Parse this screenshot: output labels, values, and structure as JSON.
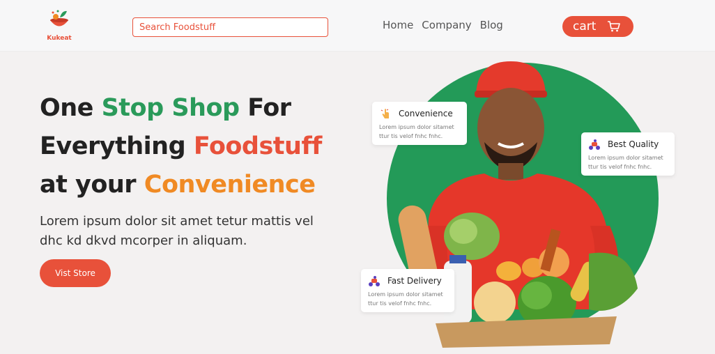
{
  "header": {
    "logo_text": "Kukeat",
    "search_placeholder": "Search Foodstuff",
    "nav": [
      "Home",
      "Company",
      "Blog"
    ],
    "cart_label": "cart"
  },
  "hero": {
    "title_line1_a": "One ",
    "title_line1_b": "Stop Shop",
    "title_line1_c": " For",
    "title_line2_a": "Everything ",
    "title_line2_b": "Foodstuff",
    "title_line3_a": "at your ",
    "title_line3_b": "Convenience",
    "subtitle": "Lorem ipsum dolor sit amet tetur mattis vel dhc kd dkvd mcorper in aliquam.",
    "button": "Vist Store"
  },
  "cards": {
    "convenience": {
      "title": "Convenience",
      "body": "Lorem ipsum dolor sitamet ttur tis velof fnhc fnhc."
    },
    "quality": {
      "title": "Best Quality",
      "body": "Lorem ipsum dolor sitamet ttur tis velof fnhc fnhc."
    },
    "delivery": {
      "title": "Fast Delivery",
      "body": "Lorem ipsum dolor sitamet ttur tis velof fnhc fnhc."
    }
  },
  "colors": {
    "accent": "#e8513a",
    "green": "#2a9a5a",
    "orange": "#f08a24"
  }
}
